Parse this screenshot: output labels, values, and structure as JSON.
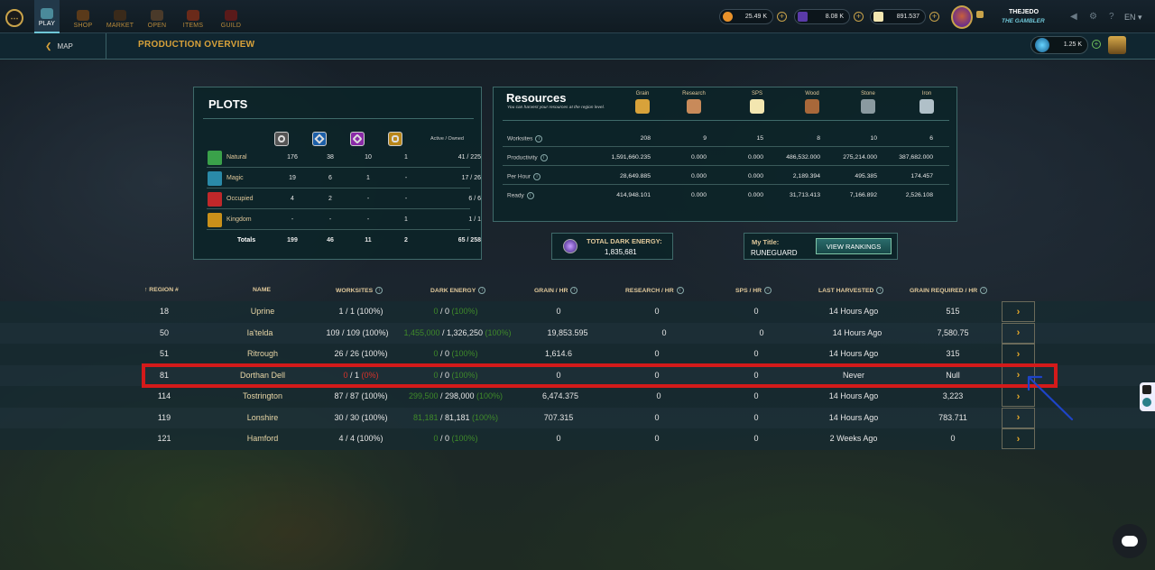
{
  "nav": {
    "tabs": [
      {
        "label": "PLAY",
        "active": true,
        "icon": "play-icon"
      },
      {
        "label": "SHOP",
        "icon": "shop-icon"
      },
      {
        "label": "MARKET",
        "icon": "market-icon"
      },
      {
        "label": "OPEN",
        "icon": "open-pack-icon"
      },
      {
        "label": "ITEMS",
        "icon": "items-icon"
      },
      {
        "label": "GUILD",
        "icon": "guild-icon"
      }
    ],
    "resources": [
      {
        "value": "25.49 K",
        "icon": "credits-icon",
        "color": "#e8912a"
      },
      {
        "value": "8.08 K",
        "icon": "dec-icon",
        "color": "#5a3aa8"
      },
      {
        "value": "891.537",
        "icon": "sps-icon",
        "color": "#f3e6b0"
      }
    ],
    "username": "THEJEDO",
    "user_title": "THE GAMBLER",
    "language": "EN"
  },
  "subheader": {
    "back_label": "MAP",
    "title": "PRODUCTION OVERVIEW",
    "energy_value": "1.25 K"
  },
  "plots": {
    "title": "PLOTS",
    "header_right": "Active / Owned",
    "type_colors": [
      "#555555",
      "#1c5fa8",
      "#8a2aa8",
      "#b8861a"
    ],
    "rows": [
      {
        "name": "Natural",
        "icon": "natural-icon",
        "color": "#3aa14a",
        "c1": "176",
        "c2": "38",
        "c3": "10",
        "c4": "1",
        "total": "41 / 225"
      },
      {
        "name": "Magic",
        "icon": "magic-icon",
        "color": "#2a8aa8",
        "c1": "19",
        "c2": "6",
        "c3": "1",
        "c4": "-",
        "total": "17 / 26"
      },
      {
        "name": "Occupied",
        "icon": "occupied-icon",
        "color": "#c0282a",
        "c1": "4",
        "c2": "2",
        "c3": "-",
        "c4": "-",
        "total": "6 / 6"
      },
      {
        "name": "Kingdom",
        "icon": "kingdom-icon",
        "color": "#c9901a",
        "c1": "-",
        "c2": "-",
        "c3": "-",
        "c4": "1",
        "total": "1 / 1"
      },
      {
        "name": "Totals",
        "c1": "199",
        "c2": "46",
        "c3": "11",
        "c4": "2",
        "total": "65 / 258"
      }
    ]
  },
  "resources": {
    "title": "Resources",
    "subtitle": "You can harvest your resources at the region level.",
    "columns": [
      {
        "label": "Grain",
        "icon": "grain-icon",
        "color": "#d8a23a"
      },
      {
        "label": "Research",
        "icon": "research-icon",
        "color": "#c88a5a"
      },
      {
        "label": "SPS",
        "icon": "sps-icon",
        "color": "#f3e6b0"
      },
      {
        "label": "Wood",
        "icon": "wood-icon",
        "color": "#a8683a"
      },
      {
        "label": "Stone",
        "icon": "stone-icon",
        "color": "#8a9aa0"
      },
      {
        "label": "Iron",
        "icon": "iron-icon",
        "color": "#b0c0c8"
      }
    ],
    "rows": [
      {
        "label": "Worksites",
        "values": [
          "208",
          "9",
          "15",
          "8",
          "10",
          "6"
        ]
      },
      {
        "label": "Productivity",
        "values": [
          "1,591,660.235",
          "0.000",
          "0.000",
          "486,532.000",
          "275,214.000",
          "387,682.000"
        ]
      },
      {
        "label": "Per Hour",
        "values": [
          "28,649.885",
          "0.000",
          "0.000",
          "2,189.394",
          "495.385",
          "174.457"
        ]
      },
      {
        "label": "Ready",
        "values": [
          "414,948.101",
          "0.000",
          "0.000",
          "31,713.413",
          "7,166.892",
          "2,526.108"
        ]
      }
    ]
  },
  "dark_energy": {
    "label": "TOTAL DARK ENERGY:",
    "value": "1,835,681"
  },
  "my_title": {
    "label": "My Title:",
    "value": "RUNEGUARD",
    "button_label": "VIEW RANKINGS"
  },
  "regions": {
    "headers": {
      "region": "REGION #",
      "name": "NAME",
      "worksites": "WORKSITES",
      "dark_energy": "DARK ENERGY",
      "grain": "GRAIN / HR",
      "research": "RESEARCH / HR",
      "sps": "SPS / HR",
      "last": "LAST HARVESTED",
      "grain_req": "GRAIN REQUIRED / HR"
    },
    "rows": [
      {
        "region": "18",
        "name": "Uprine",
        "ws_a": "1 / 1",
        "ws_pct": "(100%)",
        "de_a": "0",
        "de_b": " / 0 ",
        "de_pct": "(100%)",
        "grain": "0",
        "research": "0",
        "sps": "0",
        "last": "14 Hours Ago",
        "req": "515",
        "bg": "#162a31"
      },
      {
        "region": "50",
        "name": "Ia'telda",
        "ws_a": "109 / 109",
        "ws_pct": "(100%)",
        "de_a": "1,455,000",
        "de_b": " / 1,326,250 ",
        "de_pct": "(100%)",
        "grain": "19,853.595",
        "research": "0",
        "sps": "0",
        "last": "14 Hours Ago",
        "req": "7,580.75",
        "bg": "#1d313a"
      },
      {
        "region": "51",
        "name": "Ritrough",
        "ws_a": "26 / 26",
        "ws_pct": "(100%)",
        "de_a": "0",
        "de_b": " / 0 ",
        "de_pct": "(100%)",
        "grain": "1,614.6",
        "research": "0",
        "sps": "0",
        "last": "14 Hours Ago",
        "req": "315",
        "bg": "#162a31"
      },
      {
        "region": "81",
        "name": "Dorthan Dell",
        "ws_a": "0",
        "ws_a2": " / 1 ",
        "ws_pct": "(0%)",
        "de_a": "0",
        "de_b": " / 0 ",
        "de_pct": "(100%)",
        "grain": "0",
        "research": "0",
        "sps": "0",
        "last": "Never",
        "req": "Null",
        "bg": "#1d313a"
      },
      {
        "region": "114",
        "name": "Tostrington",
        "ws_a": "87 / 87",
        "ws_pct": "(100%)",
        "de_a": "299,500",
        "de_b": " / 298,000 ",
        "de_pct": "(100%)",
        "grain": "6,474.375",
        "research": "0",
        "sps": "0",
        "last": "14 Hours Ago",
        "req": "3,223",
        "bg": "#162a31"
      },
      {
        "region": "119",
        "name": "Lonshire",
        "ws_a": "30 / 30",
        "ws_pct": "(100%)",
        "de_a": "81,181",
        "de_b": " / 81,181 ",
        "de_pct": "(100%)",
        "grain": "707.315",
        "research": "0",
        "sps": "0",
        "last": "14 Hours Ago",
        "req": "783.711",
        "bg": "#1d313a"
      },
      {
        "region": "121",
        "name": "Hamford",
        "ws_a": "4 / 4",
        "ws_pct": "(100%)",
        "de_a": "0",
        "de_b": " / 0 ",
        "de_pct": "(100%)",
        "grain": "0",
        "research": "0",
        "sps": "0",
        "last": "2 Weeks Ago",
        "req": "0",
        "bg": "#162a31"
      }
    ],
    "go_glyph": "›"
  },
  "colors": {
    "accent_gold": "#d8a23a",
    "highlight_red": "#d41a1a",
    "positive_green": "#3f8a2a",
    "annotation_arrow": "#1e44c8"
  }
}
